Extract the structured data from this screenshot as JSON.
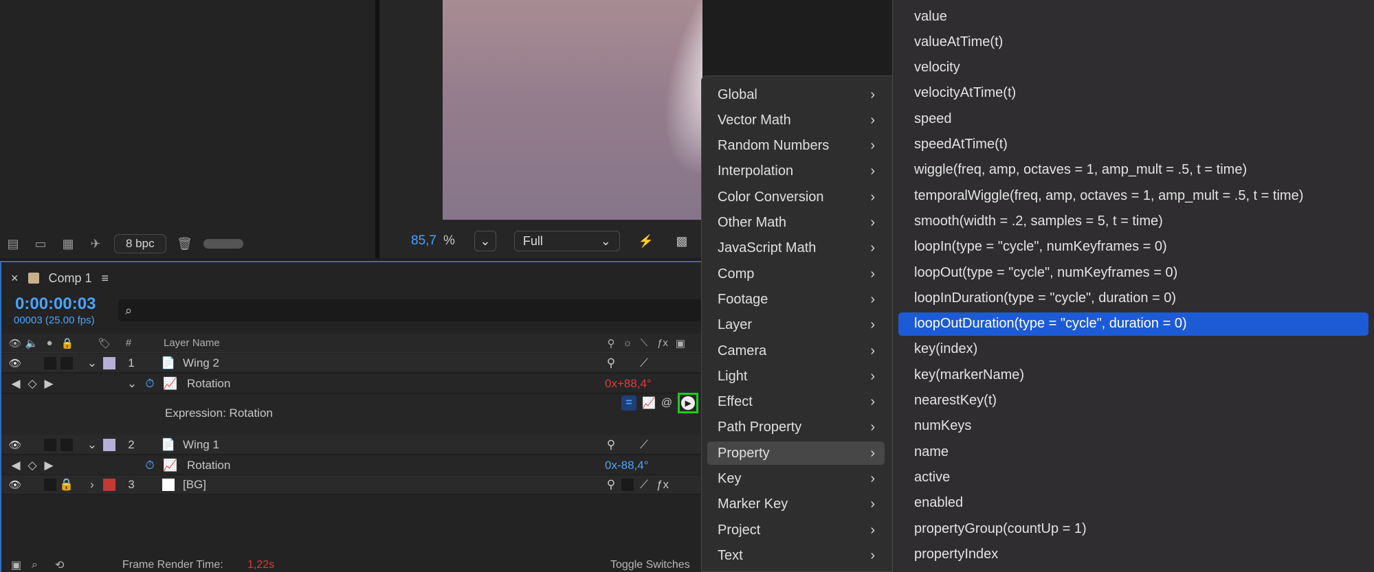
{
  "project_panel": {
    "bpc_label": "8 bpc"
  },
  "viewer": {
    "zoom_value": "85,7",
    "zoom_unit": "%",
    "resolution": "Full"
  },
  "timeline": {
    "tab_title": "Comp 1",
    "timecode": "0:00:00:03",
    "frame_info": "00003 (25.00 fps)",
    "search_placeholder": "",
    "columns": {
      "number": "#",
      "layer_name": "Layer Name"
    },
    "layers": [
      {
        "number": "1",
        "name": "Wing 2",
        "label_color": "#b6b0d6",
        "property": "Rotation",
        "rot_turns": "0",
        "rot_x": "x",
        "rot_deg": "+88,4°",
        "expression_label": "Expression: Rotation"
      },
      {
        "number": "2",
        "name": "Wing 1",
        "label_color": "#b6b0d6",
        "property": "Rotation",
        "rot_turns": "0",
        "rot_x": "x",
        "rot_deg": "-88,4°"
      },
      {
        "number": "3",
        "name": "[BG]",
        "label_color": "#c43838"
      }
    ],
    "footer": {
      "render_label": "Frame Render Time:",
      "render_value": "1,22s",
      "toggle_label": "Toggle Switches"
    }
  },
  "category_menu": [
    "Global",
    "Vector Math",
    "Random Numbers",
    "Interpolation",
    "Color Conversion",
    "Other Math",
    "JavaScript Math",
    "Comp",
    "Footage",
    "Layer",
    "Camera",
    "Light",
    "Effect",
    "Path Property",
    "Property",
    "Key",
    "Marker Key",
    "Project",
    "Text"
  ],
  "category_active": "Property",
  "member_menu": [
    "value",
    "valueAtTime(t)",
    "velocity",
    "velocityAtTime(t)",
    "speed",
    "speedAtTime(t)",
    "wiggle(freq, amp, octaves = 1, amp_mult = .5, t = time)",
    "temporalWiggle(freq, amp, octaves = 1, amp_mult = .5, t = time)",
    "smooth(width = .2, samples = 5, t = time)",
    "loopIn(type = \"cycle\", numKeyframes = 0)",
    "loopOut(type = \"cycle\", numKeyframes = 0)",
    "loopInDuration(type = \"cycle\", duration = 0)",
    "loopOutDuration(type = \"cycle\", duration = 0)",
    "key(index)",
    "key(markerName)",
    "nearestKey(t)",
    "numKeys",
    "name",
    "active",
    "enabled",
    "propertyGroup(countUp = 1)",
    "propertyIndex"
  ],
  "member_selected": "loopOutDuration(type = \"cycle\", duration = 0)",
  "colors": {
    "accent": "#4aa3ff",
    "selection": "#1d5bd6",
    "highlight_outline": "#17d117",
    "negative": "#e23b3b"
  }
}
